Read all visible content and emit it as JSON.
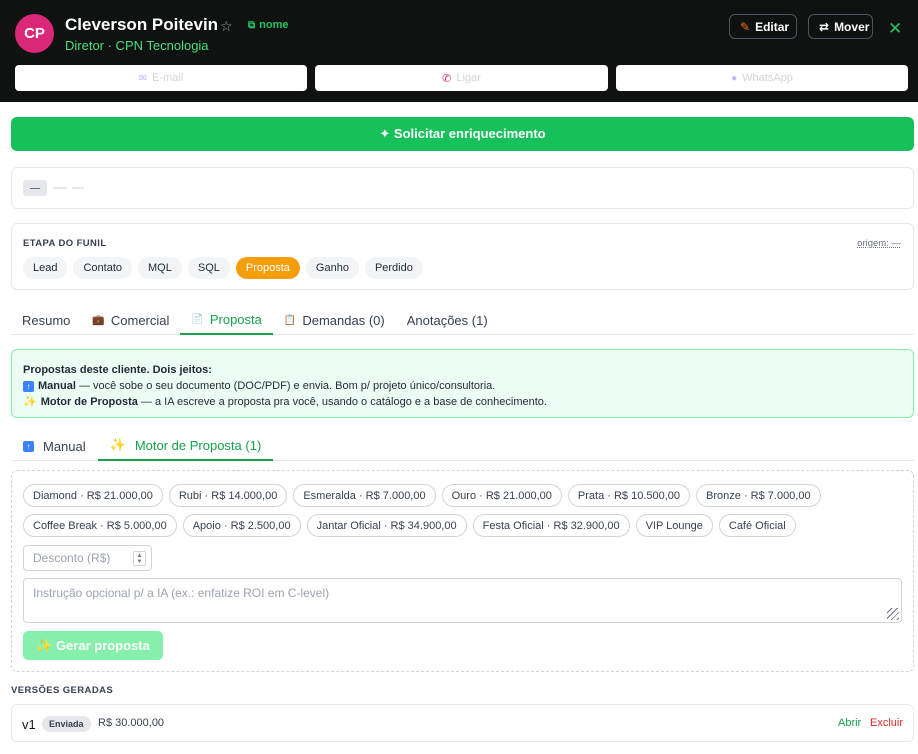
{
  "contact": {
    "initials": "CP",
    "name": "Cleverson Poitevin",
    "copy_label": "nome",
    "subtitle": "Diretor · CPN Tecnologia"
  },
  "header_actions": {
    "edit_label": "Editar",
    "move_label": "Mover"
  },
  "contact_actions": {
    "email_label": "E-mail",
    "call_label": "Ligar",
    "whatsapp_label": "WhatsApp"
  },
  "enrich": {
    "label": "✦ Solicitar enriquecimento"
  },
  "placeholder": {
    "chip": "—"
  },
  "funnel": {
    "title": "ETAPA DO FUNIL",
    "origin": "origem: —",
    "stages": [
      "Lead",
      "Contato",
      "MQL",
      "SQL",
      "Proposta",
      "Ganho",
      "Perdido"
    ],
    "active_stage": "Proposta"
  },
  "tabs": [
    {
      "label": "Resumo",
      "icon": ""
    },
    {
      "label": "Comercial",
      "icon": "briefcase-icon"
    },
    {
      "label": "Proposta",
      "icon": "document-icon"
    },
    {
      "label": "Demandas (0)",
      "icon": "clipboard-icon"
    },
    {
      "label": "Anotações (1)",
      "icon": ""
    }
  ],
  "active_tab": "Proposta",
  "info": {
    "heading": "Propostas deste cliente. Dois jeitos:",
    "manual_title": "Manual",
    "manual_text": " — você sobe o seu documento (DOC/PDF) e envia. Bom p/ projeto único/consultoria.",
    "engine_title": "Motor de Proposta",
    "engine_text": " — a IA escreve a proposta pra você, usando o catálogo e a base de conhecimento."
  },
  "subtabs": {
    "manual_label": "Manual",
    "engine_label": "Motor de Proposta (1)"
  },
  "products": [
    "Diamond · R$ 21.000,00",
    "Rubi · R$ 14.000,00",
    "Esmeralda · R$ 7.000,00",
    "Ouro · R$ 21.000,00",
    "Prata · R$ 10.500,00",
    "Bronze · R$ 7.000,00",
    "Coffee Break · R$ 5.000,00",
    "Apoio · R$ 2.500,00",
    "Jantar Oficial · R$ 34.900,00",
    "Festa Oficial · R$ 32.900,00",
    "VIP Lounge",
    "Café Oficial"
  ],
  "form": {
    "discount_placeholder": "Desconto (R$)",
    "instruction_placeholder": "Instrução opcional p/ a IA (ex.: enfatize ROI em C-level)",
    "generate_label": "✨ Gerar proposta"
  },
  "versions": {
    "title": "VERSÕES GERADAS",
    "items": [
      {
        "version": "v1",
        "status": "Enviada",
        "value": "R$ 30.000,00",
        "open_label": "Abrir",
        "delete_label": "Excluir"
      }
    ]
  },
  "colors": {
    "accent": "#16c05a",
    "active_stage": "#f59e0b",
    "avatar": "#db2777",
    "header_bg": "#0f1210"
  }
}
